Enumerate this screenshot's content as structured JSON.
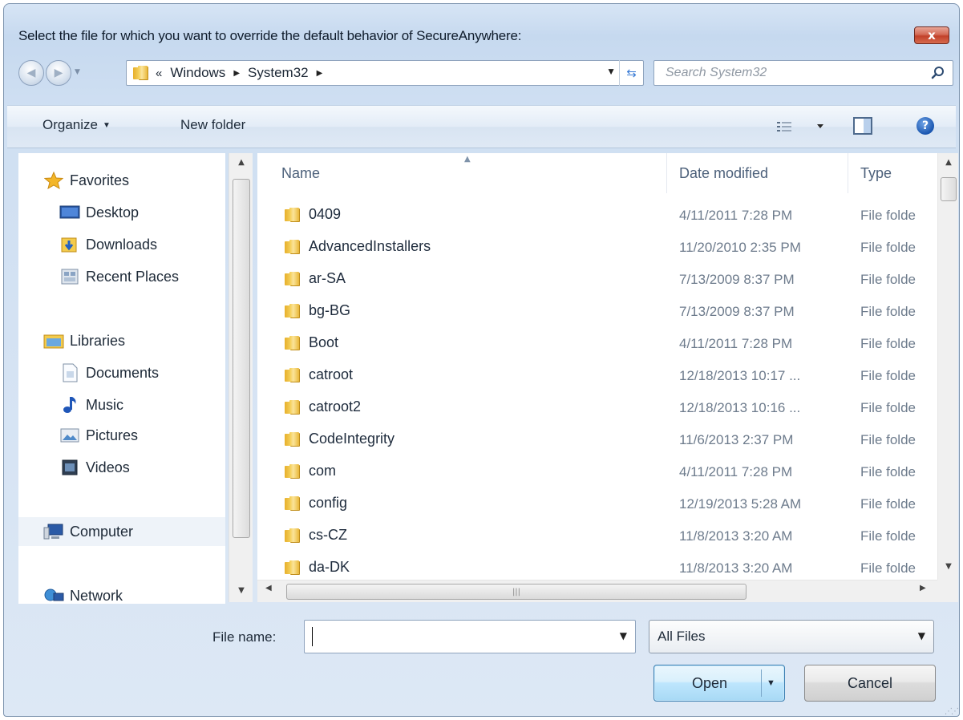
{
  "window": {
    "title": "Select the file for which you want to override the default behavior of SecureAnywhere:",
    "close_label": "x"
  },
  "address_bar": {
    "overflow_chevron": "«",
    "path": [
      "Windows",
      "System32"
    ],
    "search_placeholder": "Search System32"
  },
  "toolbar": {
    "organize_label": "Organize",
    "new_folder_label": "New folder"
  },
  "nav_pane": {
    "favorites": {
      "label": "Favorites",
      "icon": "star-icon"
    },
    "favorites_items": [
      {
        "label": "Desktop",
        "icon": "desktop-icon"
      },
      {
        "label": "Downloads",
        "icon": "downloads-icon"
      },
      {
        "label": "Recent Places",
        "icon": "recent-places-icon"
      }
    ],
    "libraries": {
      "label": "Libraries",
      "icon": "libraries-icon"
    },
    "libraries_items": [
      {
        "label": "Documents",
        "icon": "documents-icon"
      },
      {
        "label": "Music",
        "icon": "music-icon"
      },
      {
        "label": "Pictures",
        "icon": "pictures-icon"
      },
      {
        "label": "Videos",
        "icon": "videos-icon"
      }
    ],
    "computer": {
      "label": "Computer",
      "icon": "computer-icon"
    },
    "network": {
      "label": "Network",
      "icon": "network-icon"
    }
  },
  "file_list": {
    "columns": {
      "name": "Name",
      "date": "Date modified",
      "type": "Type"
    },
    "rows": [
      {
        "name": "0409",
        "date": "4/11/2011 7:28 PM",
        "type": "File folde"
      },
      {
        "name": "AdvancedInstallers",
        "date": "11/20/2010 2:35 PM",
        "type": "File folde"
      },
      {
        "name": "ar-SA",
        "date": "7/13/2009 8:37 PM",
        "type": "File folde"
      },
      {
        "name": "bg-BG",
        "date": "7/13/2009 8:37 PM",
        "type": "File folde"
      },
      {
        "name": "Boot",
        "date": "4/11/2011 7:28 PM",
        "type": "File folde"
      },
      {
        "name": "catroot",
        "date": "12/18/2013 10:17 ...",
        "type": "File folde"
      },
      {
        "name": "catroot2",
        "date": "12/18/2013 10:16 ...",
        "type": "File folde"
      },
      {
        "name": "CodeIntegrity",
        "date": "11/6/2013 2:37 PM",
        "type": "File folde"
      },
      {
        "name": "com",
        "date": "4/11/2011 7:28 PM",
        "type": "File folde"
      },
      {
        "name": "config",
        "date": "12/19/2013 5:28 AM",
        "type": "File folde"
      },
      {
        "name": "cs-CZ",
        "date": "11/8/2013 3:20 AM",
        "type": "File folde"
      },
      {
        "name": "da-DK",
        "date": "11/8/2013 3:20 AM",
        "type": "File folde"
      }
    ]
  },
  "bottom": {
    "file_name_label": "File name:",
    "file_name_value": "",
    "filter_value": "All Files",
    "open_label": "Open",
    "cancel_label": "Cancel"
  },
  "colors": {
    "accent": "#3c7fb1",
    "folder": "#f3cb4c",
    "close": "#c2412a"
  }
}
